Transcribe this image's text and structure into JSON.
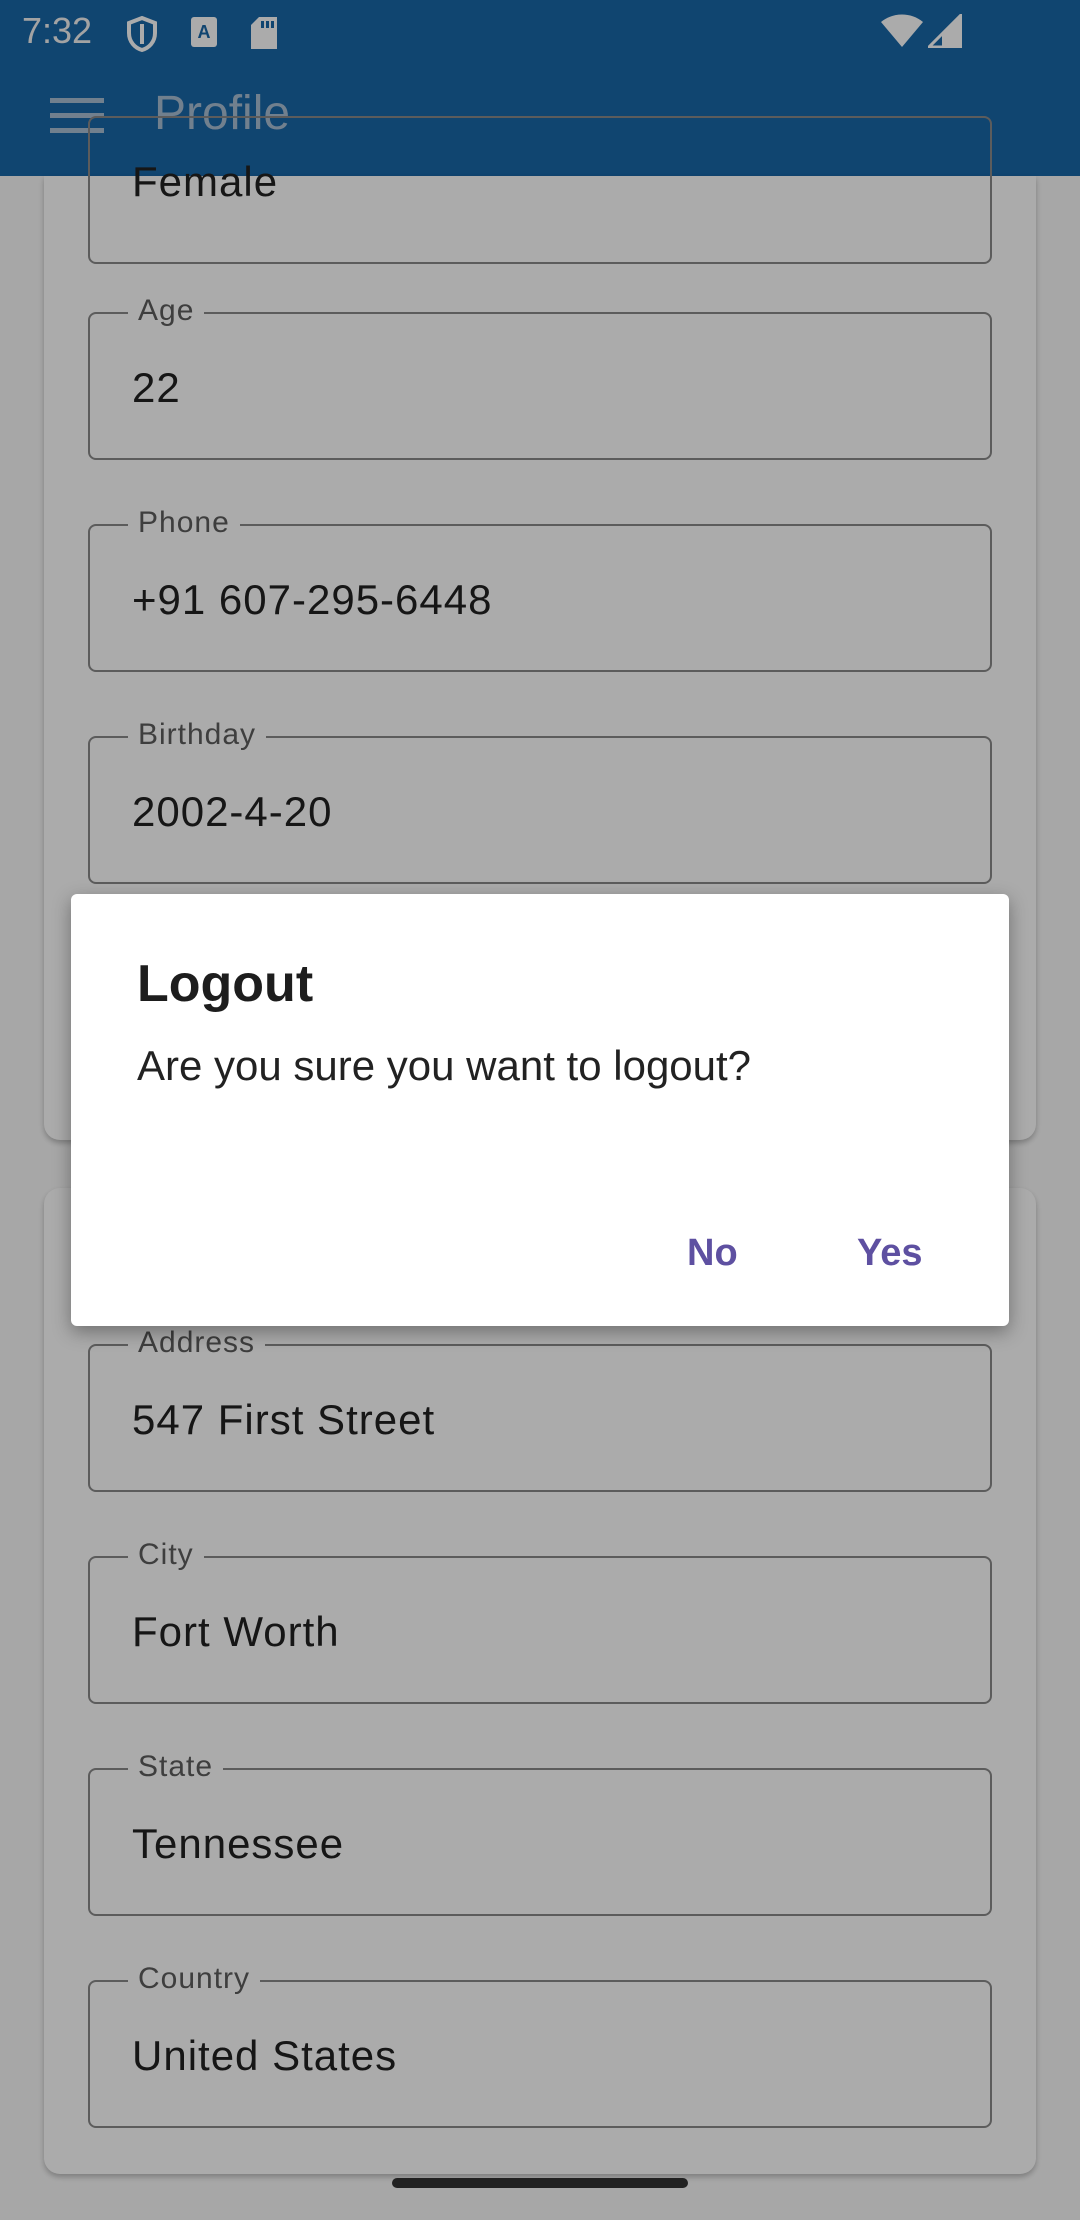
{
  "status_bar": {
    "time": "7:32",
    "icons": [
      "shield-icon",
      "a-icon",
      "sd-card-icon",
      "wifi-icon",
      "signal-icon"
    ]
  },
  "app_bar": {
    "title": "Profile",
    "menu_icon": "hamburger-menu-icon"
  },
  "profile": {
    "gender_value": "Female",
    "age": {
      "label": "Age",
      "value": "22"
    },
    "phone": {
      "label": "Phone",
      "value": "+91 607-295-6448"
    },
    "birthday": {
      "label": "Birthday",
      "value": "2002-4-20"
    }
  },
  "address_card": {
    "address": {
      "label": "Address",
      "value": "547 First Street"
    },
    "city": {
      "label": "City",
      "value": "Fort Worth"
    },
    "state": {
      "label": "State",
      "value": "Tennessee"
    },
    "country": {
      "label": "Country",
      "value": "United States"
    }
  },
  "dialog": {
    "title": "Logout",
    "message": "Are you sure you want to logout?",
    "no_label": "No",
    "yes_label": "Yes"
  },
  "colors": {
    "app_bar": "#1867a8",
    "dialog_button": "#5e50a1"
  }
}
